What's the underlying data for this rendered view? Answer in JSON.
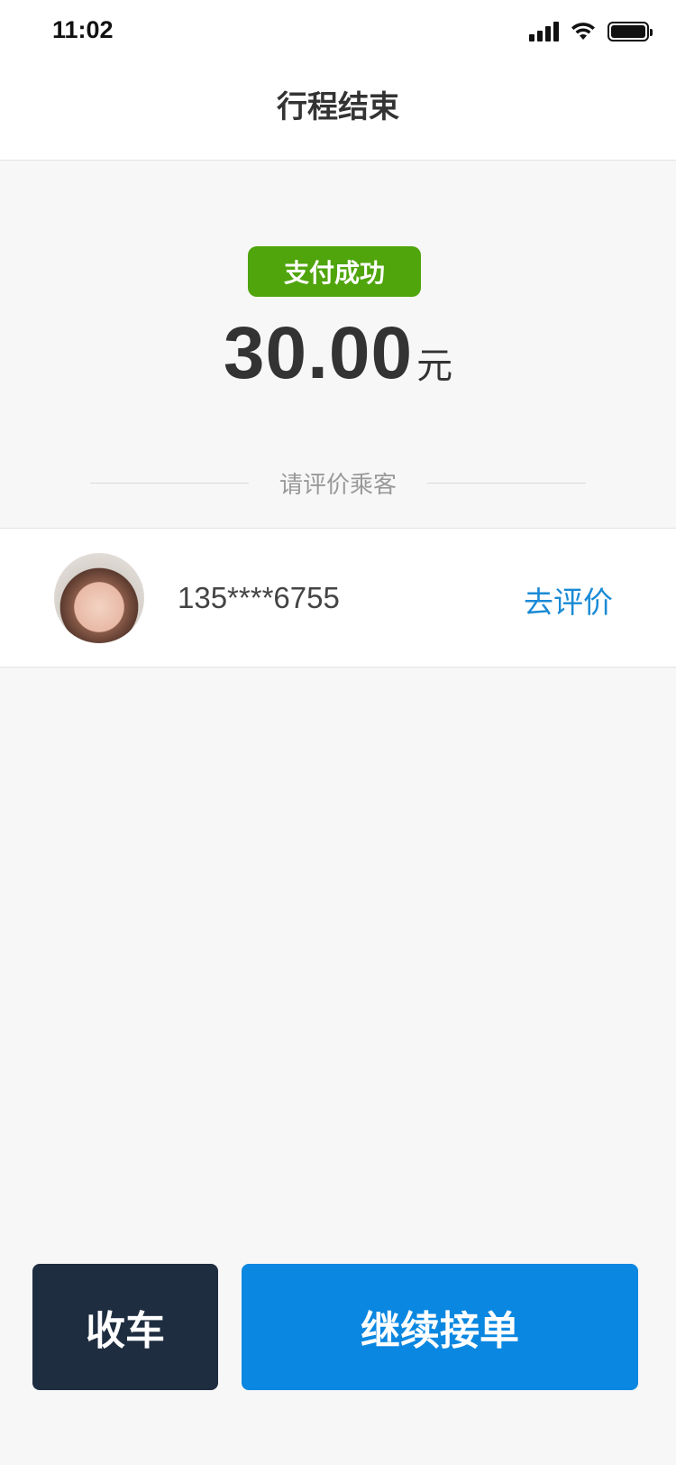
{
  "status_bar": {
    "time": "11:02"
  },
  "header": {
    "title": "行程结束"
  },
  "payment": {
    "badge": "支付成功",
    "amount": "30.00",
    "unit": "元"
  },
  "rating": {
    "section_label": "请评价乘客",
    "passenger_phone": "135****6755",
    "action_label": "去评价"
  },
  "actions": {
    "stop_label": "收车",
    "continue_label": "继续接单"
  },
  "colors": {
    "success": "#4fa50b",
    "accent": "#0a87e0",
    "dark_button": "#1f2d40",
    "link": "#1a8ad6"
  }
}
